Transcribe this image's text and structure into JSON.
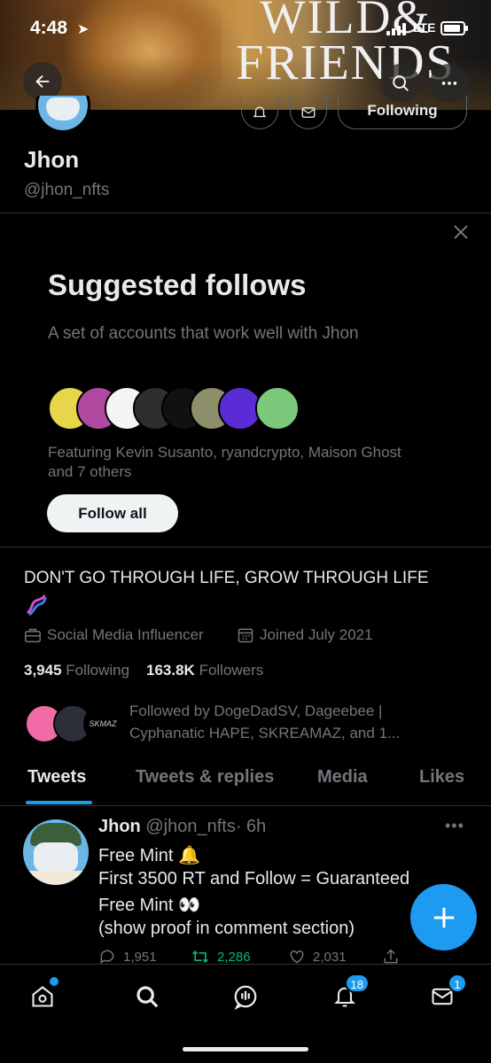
{
  "status_bar": {
    "time": "4:48",
    "network": "LTE"
  },
  "banner": {
    "title_line1": "WILD&",
    "title_line2": "FRIENDS"
  },
  "profile": {
    "name": "Jhon",
    "handle": "@jhon_nfts",
    "following_button": "Following",
    "bio": "DON'T GO THROUGH LIFE, GROW THROUGH LIFE",
    "category": "Social Media Influencer",
    "joined": "Joined July 2021",
    "following_count": "3,945",
    "following_label": "Following",
    "followers_count": "163.8K",
    "followers_label": "Followers",
    "followed_by_line1": "Followed by DogeDadSV, Dageebee |",
    "followed_by_line2": "Cyphanatic HAPE, SKREAMAZ, and 1...",
    "followed_avatar_text": "SKMAZ"
  },
  "suggested": {
    "title": "Suggested follows",
    "subtitle": "A set of accounts that work well with Jhon",
    "featuring_line1": "Featuring Kevin Susanto, ryandcrypto, Maison Ghost",
    "featuring_line2": "and 7 others",
    "button": "Follow all"
  },
  "tabs": [
    "Tweets",
    "Tweets & replies",
    "Media",
    "Likes"
  ],
  "tweet": {
    "name": "Jhon",
    "handle": "@jhon_nfts",
    "time": "· 6h",
    "line1": "Free Mint 🔔",
    "line2": "First 3500 RT and Follow  = Guaranteed",
    "line3": "Free Mint 👀",
    "line4": "(show proof in comment section)",
    "replies": "1,951",
    "retweets": "2,286",
    "likes": "2,031"
  },
  "nav": {
    "notifications_badge": "18",
    "messages_badge": "1"
  },
  "colors": {
    "accent": "#1d9bf0",
    "retweet_green": "#00ba7c",
    "muted": "#71767b",
    "background": "#000000"
  }
}
